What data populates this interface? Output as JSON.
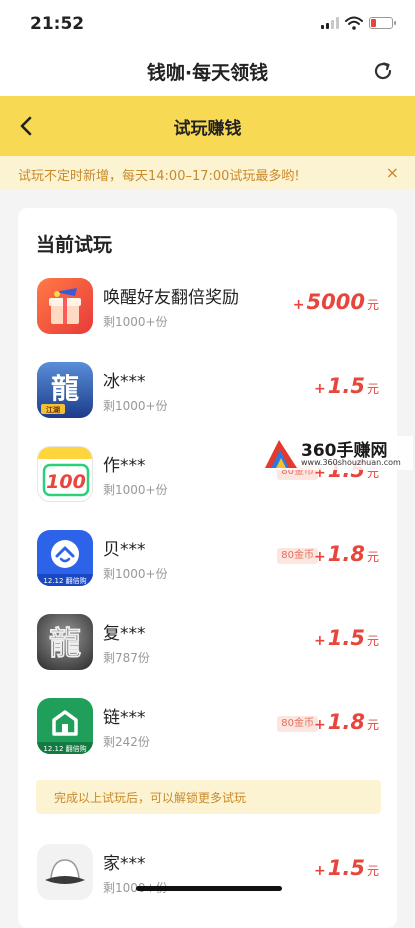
{
  "status_bar": {
    "time": "21:52"
  },
  "header": {
    "title": "钱咖·每天领钱"
  },
  "nav": {
    "title": "试玩赚钱"
  },
  "notice": {
    "text": "试玩不定时新增，每天14:00–17:00试玩最多哟!",
    "close": "×"
  },
  "section": {
    "title": "当前试玩"
  },
  "tasks": [
    {
      "name": "唤醒好友翻倍奖励",
      "stock": "剩1000+份",
      "badge": "",
      "plus": "+",
      "amount": "5000",
      "unit": "元",
      "icon": "gift-box-icon"
    },
    {
      "name": "冰***",
      "stock": "剩1000+份",
      "badge": "",
      "plus": "+",
      "amount": "1.5",
      "unit": "元",
      "icon": "dragon-game-icon"
    },
    {
      "name": "作***",
      "stock": "剩1000+份",
      "badge": "80金币",
      "plus": "+",
      "amount": "1.5",
      "unit": "元",
      "icon": "score-100-icon"
    },
    {
      "name": "贝***",
      "stock": "剩1000+份",
      "badge": "80金币",
      "plus": "+",
      "amount": "1.8",
      "unit": "元",
      "icon": "house-app-icon"
    },
    {
      "name": "复***",
      "stock": "剩787份",
      "badge": "",
      "plus": "+",
      "amount": "1.5",
      "unit": "元",
      "icon": "dark-dragon-icon"
    },
    {
      "name": "链***",
      "stock": "剩242份",
      "badge": "80金币",
      "plus": "+",
      "amount": "1.8",
      "unit": "元",
      "icon": "green-house-icon"
    },
    {
      "name": "家***",
      "stock": "剩1000+份",
      "badge": "",
      "plus": "+",
      "amount": "1.5",
      "unit": "元",
      "icon": "hat-app-icon"
    }
  ],
  "icon_labels": {
    "dragon": "龍",
    "dragon_sub": "江湖",
    "score": "100",
    "promo": "12.12 翻倍购"
  },
  "unlock": {
    "text": "完成以上试玩后，可以解锁更多试玩"
  },
  "watermark": {
    "text": "360手赚网",
    "url": "www.360shouzhuan.com"
  },
  "colors": {
    "accent": "#f8d954",
    "reward": "#e8453c",
    "notice_text": "#c98a2a"
  }
}
